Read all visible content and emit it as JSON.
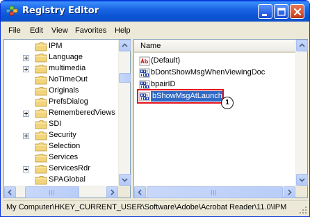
{
  "window": {
    "title": "Registry Editor",
    "icons": {
      "app": "registry-editor-icon",
      "minimize": "minimize-icon",
      "maximize": "maximize-icon",
      "close": "close-icon"
    }
  },
  "menu": [
    "File",
    "Edit",
    "View",
    "Favorites",
    "Help"
  ],
  "tree": {
    "items": [
      {
        "label": "IPM",
        "expandable": false
      },
      {
        "label": "Language",
        "expandable": true
      },
      {
        "label": "multimedia",
        "expandable": true
      },
      {
        "label": "NoTimeOut",
        "expandable": false
      },
      {
        "label": "Originals",
        "expandable": false
      },
      {
        "label": "PrefsDialog",
        "expandable": false
      },
      {
        "label": "RememberedViews",
        "expandable": true
      },
      {
        "label": "SDI",
        "expandable": false
      },
      {
        "label": "Security",
        "expandable": true
      },
      {
        "label": "Selection",
        "expandable": false
      },
      {
        "label": "Services",
        "expandable": false
      },
      {
        "label": "ServicesRdr",
        "expandable": true
      },
      {
        "label": "SPAGlobal",
        "expandable": false
      }
    ]
  },
  "values": {
    "column_header": "Name",
    "items": [
      {
        "label": "(Default)",
        "type": "string-value-icon",
        "selected": false
      },
      {
        "label": "bDontShowMsgWhenViewingDoc",
        "type": "binary-value-icon",
        "selected": false
      },
      {
        "label": "bpairID",
        "type": "binary-value-icon",
        "selected": false
      },
      {
        "label": "bShowMsgAtLaunch",
        "type": "binary-value-icon",
        "selected": true
      }
    ],
    "callout": "1",
    "highlight_color": "#e8121a",
    "selection_color": "#316ac5"
  },
  "status": {
    "path": "My Computer\\HKEY_CURRENT_USER\\Software\\Adobe\\Acrobat Reader\\11.0\\IPM"
  },
  "colors": {
    "titlebar": "#0b55d4",
    "window_bg": "#ece9d8",
    "folder": "#f2d47a"
  }
}
